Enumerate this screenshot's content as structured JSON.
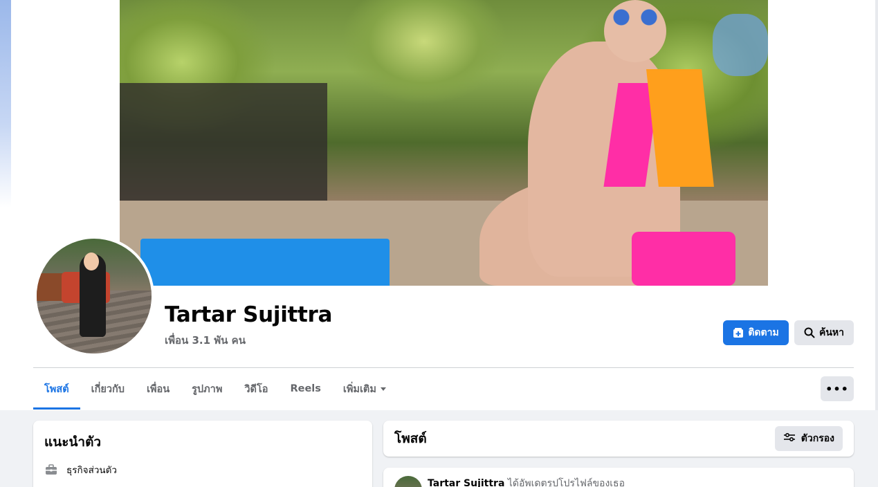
{
  "profile": {
    "name": "Tartar Sujittra",
    "friends": "เพื่อน 3.1 พัน คน"
  },
  "actions": {
    "follow_label": "ติดตาม",
    "search_label": "ค้นหา",
    "more_label": "•••"
  },
  "tabs": [
    {
      "label": "โพสต์",
      "active": true
    },
    {
      "label": "เกี่ยวกับ",
      "active": false
    },
    {
      "label": "เพื่อน",
      "active": false
    },
    {
      "label": "รูปภาพ",
      "active": false
    },
    {
      "label": "วิดีโอ",
      "active": false
    },
    {
      "label": "Reels",
      "active": false
    },
    {
      "label": "เพิ่มเติม",
      "active": false
    }
  ],
  "intro": {
    "title": "แนะนำตัว",
    "items": [
      {
        "icon": "briefcase-icon",
        "label": "ธุรกิจส่วนตัว"
      }
    ]
  },
  "posts": {
    "title": "โพสต์",
    "filter_label": "ตัวกรอง",
    "first_post": {
      "author": "Tartar Sujittra",
      "action": "ได้อัพเดตรูปโปรไฟล์ของเธอ"
    }
  },
  "colors": {
    "accent": "#1b74e4",
    "button_gray": "#e4e6eb",
    "text_primary": "#050505",
    "text_secondary": "#65676b",
    "background": "#f0f2f5"
  }
}
